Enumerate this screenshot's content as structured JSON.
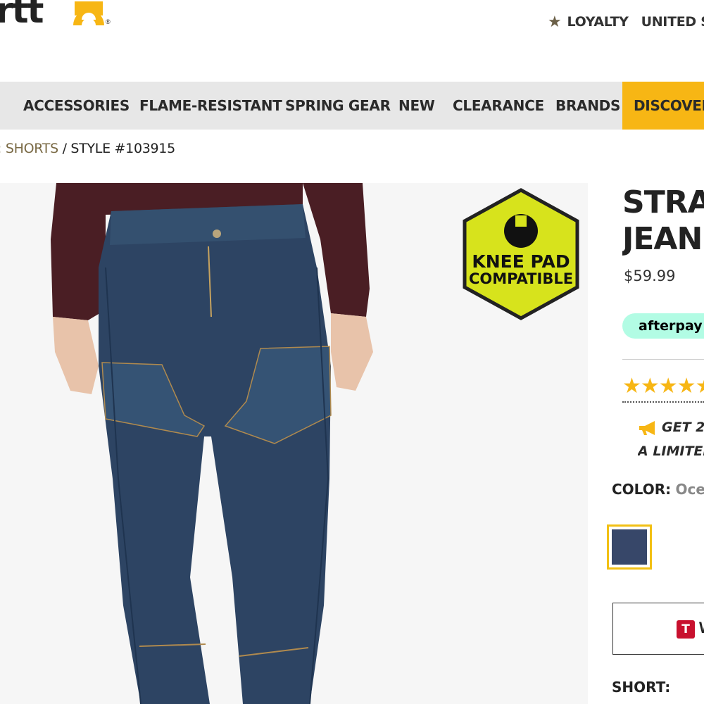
{
  "header": {
    "logo_text": "rtt",
    "logo_reg": "®",
    "utility_nav": {
      "star_icon": "star-icon",
      "loyalty_label": "LOYALTY",
      "country_label": "UNITED STATES"
    }
  },
  "main_nav": {
    "items": [
      "ACCESSORIES",
      "FLAME-RESISTANT",
      "SPRING GEAR",
      "NEW",
      "CLEARANCE",
      "BRANDS",
      "DISCOVER"
    ]
  },
  "breadcrumb": {
    "link": ": SHORTS",
    "current": "/ STYLE #103915"
  },
  "badge": {
    "line1": "KNEE PAD",
    "line2": "COMPATIBLE"
  },
  "product": {
    "title_line1": "STRAIGHT",
    "title_line2": "JEAN",
    "price": "$59.99",
    "afterpay_label": "afterpay",
    "rating_stars": "★★★★★",
    "rating_value": 5,
    "promo_line1": "GET 2",
    "promo_line2": "A LIMITED",
    "color_key": "COLOR:",
    "color_value": "Ocean",
    "swatch_color": "#374769",
    "wishlist_icon_letter": "T",
    "wishlist_text": "W",
    "short_label": "SHORT:"
  },
  "colors": {
    "accent": "#f7b614",
    "nav_bg": "#e7e7e7",
    "afterpay_bg": "#b2fce4",
    "badge_bg": "#d7e31c"
  }
}
